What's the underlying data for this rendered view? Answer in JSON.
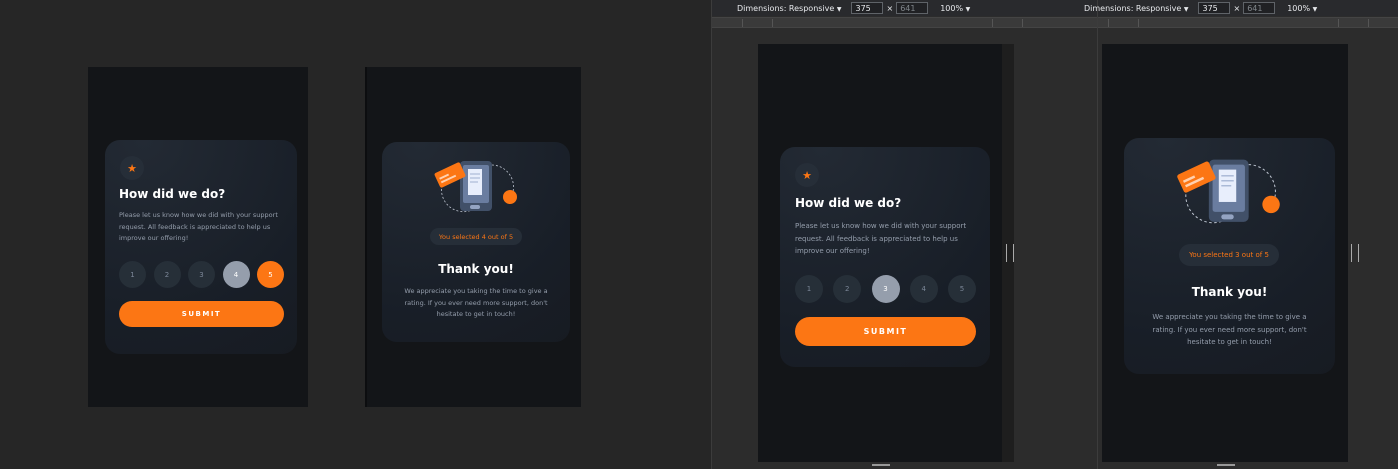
{
  "rating_card": {
    "title": "How did we do?",
    "description": "Please let us know how we did with your support request. All feedback is appreciated to help us improve our offering!",
    "ratings": [
      "1",
      "2",
      "3",
      "4",
      "5"
    ],
    "submit_label": "SUBMIT"
  },
  "thanks_card_a": {
    "selected_text": "You selected 4 out of 5",
    "title": "Thank you!",
    "description": "We appreciate you taking the time to give a rating. If you ever need more support, don't hesitate to get in touch!"
  },
  "thanks_card_b": {
    "selected_text": "You selected 3 out of 5",
    "title": "Thank you!",
    "description": "We appreciate you taking the time to give a rating. If you ever need more support, don't hesitate to get in touch!"
  },
  "devtools": {
    "dimensions_label": "Dimensions: Responsive",
    "width_value": "375",
    "times_sign": "×",
    "height_value": "641",
    "zoom_label": "100%",
    "dropdown_arrow": "▼"
  },
  "devtools_b": {
    "dimensions_label": "Dimensions: Responsive",
    "width_value": "375",
    "height_value": "641",
    "zoom_label": "100%"
  },
  "colors": {
    "accent": "#fc7614",
    "selected_gray": "#959eac",
    "card_bg": "#1e252f",
    "page_bg": "#131518"
  }
}
